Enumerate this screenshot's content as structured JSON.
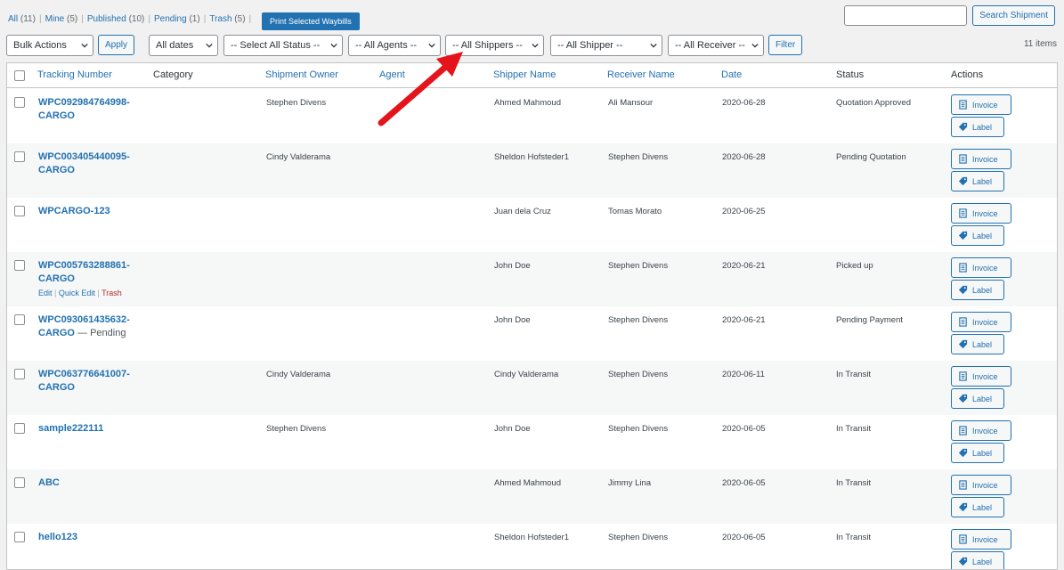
{
  "status_links": [
    {
      "label": "All",
      "count": "(11)"
    },
    {
      "label": "Mine",
      "count": "(5)"
    },
    {
      "label": "Published",
      "count": "(10)"
    },
    {
      "label": "Pending",
      "count": "(1)"
    },
    {
      "label": "Trash",
      "count": "(5)"
    }
  ],
  "print_button": "Print Selected Waybills",
  "search": {
    "button": "Search Shipment",
    "value": ""
  },
  "filters": {
    "bulk_actions": "Bulk Actions",
    "apply": "Apply",
    "dates": "All dates",
    "status": "-- Select All Status --",
    "agents": "-- All Agents --",
    "shippers": "-- All Shippers --",
    "shipper": "-- All Shipper --",
    "receiver": "-- All Receiver --",
    "filter_button": "Filter"
  },
  "items_count": "11 items",
  "columns": {
    "tracking": "Tracking Number",
    "category": "Category",
    "owner": "Shipment Owner",
    "agent": "Agent",
    "shipper": "Shipper Name",
    "receiver": "Receiver Name",
    "date": "Date",
    "status": "Status",
    "actions": "Actions"
  },
  "row_actions": {
    "edit": "Edit",
    "quick_edit": "Quick Edit",
    "trash": "Trash"
  },
  "action_labels": {
    "invoice": "Invoice",
    "label": "Label"
  },
  "rows": [
    {
      "tracking_1": "WPC092984764998-",
      "tracking_2": "CARGO",
      "owner": "Stephen Divens",
      "shipper": "Ahmed Mahmoud",
      "receiver": "Ali Mansour",
      "date": "2020-06-28",
      "status": "Quotation Approved"
    },
    {
      "tracking_1": "WPC003405440095-",
      "tracking_2": "CARGO",
      "owner": "Cindy Valderama",
      "shipper": "Sheldon Hofsteder1",
      "receiver": "Stephen Divens",
      "date": "2020-06-28",
      "status": "Pending Quotation"
    },
    {
      "tracking_1": "WPCARGO-123",
      "tracking_2": "",
      "owner": "",
      "shipper": "Juan dela Cruz",
      "receiver": "Tomas Morato",
      "date": "2020-06-25",
      "status": ""
    },
    {
      "tracking_1": "WPC005763288861-",
      "tracking_2": "CARGO",
      "owner": "",
      "shipper": "John Doe",
      "receiver": "Stephen Divens",
      "date": "2020-06-21",
      "status": "Picked up"
    },
    {
      "tracking_1": "WPC093061435632-",
      "tracking_2": "CARGO",
      "tracking_suffix": " — Pending",
      "owner": "",
      "shipper": "John Doe",
      "receiver": "Stephen Divens",
      "date": "2020-06-21",
      "status": "Pending Payment"
    },
    {
      "tracking_1": "WPC063776641007-",
      "tracking_2": "CARGO",
      "owner": "Cindy Valderama",
      "shipper": "Cindy Valderama",
      "receiver": "Stephen Divens",
      "date": "2020-06-11",
      "status": "In Transit"
    },
    {
      "tracking_1": "sample222111",
      "tracking_2": "",
      "owner": "Stephen Divens",
      "shipper": "John Doe",
      "receiver": "Stephen Divens",
      "date": "2020-06-05",
      "status": "In Transit"
    },
    {
      "tracking_1": "ABC",
      "tracking_2": "",
      "owner": "",
      "shipper": "Ahmed Mahmoud",
      "receiver": "Jimmy Lina",
      "date": "2020-06-05",
      "status": "In Transit"
    },
    {
      "tracking_1": "hello123",
      "tracking_2": "",
      "owner": "",
      "shipper": "Sheldon Hofsteder1",
      "receiver": "Stephen Divens",
      "date": "2020-06-05",
      "status": "In Transit"
    }
  ]
}
